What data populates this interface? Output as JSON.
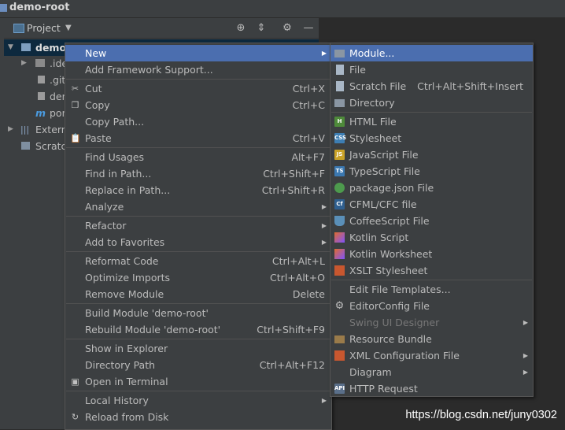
{
  "window": {
    "title": "demo-root"
  },
  "panel": {
    "title": "Project",
    "tree": [
      {
        "label": "demo-",
        "bold": true
      },
      {
        "label": ".ide"
      },
      {
        "label": ".giti"
      },
      {
        "label": "dem"
      },
      {
        "label": "pon"
      },
      {
        "label": "Externa"
      },
      {
        "label": "Scratch"
      }
    ]
  },
  "context_menu": {
    "items": [
      {
        "label": "New",
        "shortcut": "",
        "submenu": true
      },
      {
        "label": "Add Framework Support...",
        "shortcut": ""
      },
      {
        "label": "Cut",
        "shortcut": "Ctrl+X",
        "icon": "cut-icon"
      },
      {
        "label": "Copy",
        "shortcut": "Ctrl+C",
        "icon": "copy-icon"
      },
      {
        "label": "Copy Path...",
        "shortcut": ""
      },
      {
        "label": "Paste",
        "shortcut": "Ctrl+V",
        "icon": "paste-icon"
      },
      {
        "label": "Find Usages",
        "shortcut": "Alt+F7"
      },
      {
        "label": "Find in Path...",
        "shortcut": "Ctrl+Shift+F"
      },
      {
        "label": "Replace in Path...",
        "shortcut": "Ctrl+Shift+R"
      },
      {
        "label": "Analyze",
        "shortcut": "",
        "submenu": true
      },
      {
        "label": "Refactor",
        "shortcut": "",
        "submenu": true
      },
      {
        "label": "Add to Favorites",
        "shortcut": "",
        "submenu": true
      },
      {
        "label": "Reformat Code",
        "shortcut": "Ctrl+Alt+L"
      },
      {
        "label": "Optimize Imports",
        "shortcut": "Ctrl+Alt+O"
      },
      {
        "label": "Remove Module",
        "shortcut": "Delete"
      },
      {
        "label": "Build Module 'demo-root'",
        "shortcut": ""
      },
      {
        "label": "Rebuild Module 'demo-root'",
        "shortcut": "Ctrl+Shift+F9"
      },
      {
        "label": "Show in Explorer",
        "shortcut": ""
      },
      {
        "label": "Directory Path",
        "shortcut": "Ctrl+Alt+F12"
      },
      {
        "label": "Open in Terminal",
        "shortcut": "",
        "icon": "terminal-icon"
      },
      {
        "label": "Local History",
        "shortcut": "",
        "submenu": true
      },
      {
        "label": "Reload from Disk",
        "shortcut": "",
        "icon": "reload-icon"
      }
    ]
  },
  "new_submenu": {
    "items": [
      {
        "label": "Module...",
        "shortcut": "",
        "icon": "module-icon"
      },
      {
        "label": "File",
        "shortcut": "",
        "icon": "file-icon"
      },
      {
        "label": "Scratch File",
        "shortcut": "Ctrl+Alt+Shift+Insert",
        "icon": "scratch-file-icon"
      },
      {
        "label": "Directory",
        "shortcut": "",
        "icon": "folder-icon"
      },
      {
        "label": "HTML File",
        "shortcut": "",
        "icon": "html-icon",
        "badge": "H"
      },
      {
        "label": "Stylesheet",
        "shortcut": "",
        "icon": "css-icon",
        "badge": "CSS"
      },
      {
        "label": "JavaScript File",
        "shortcut": "",
        "icon": "javascript-icon",
        "badge": "JS"
      },
      {
        "label": "TypeScript File",
        "shortcut": "",
        "icon": "typescript-icon",
        "badge": "TS"
      },
      {
        "label": "package.json File",
        "shortcut": "",
        "icon": "npm-icon"
      },
      {
        "label": "CFML/CFC file",
        "shortcut": "",
        "icon": "cfml-icon",
        "badge": "Cf"
      },
      {
        "label": "CoffeeScript File",
        "shortcut": "",
        "icon": "coffeescript-icon"
      },
      {
        "label": "Kotlin Script",
        "shortcut": "",
        "icon": "kotlin-icon"
      },
      {
        "label": "Kotlin Worksheet",
        "shortcut": "",
        "icon": "kotlin-icon"
      },
      {
        "label": "XSLT Stylesheet",
        "shortcut": "",
        "icon": "xslt-icon"
      },
      {
        "label": "Edit File Templates...",
        "shortcut": ""
      },
      {
        "label": "EditorConfig File",
        "shortcut": "",
        "icon": "gear-icon"
      },
      {
        "label": "Swing UI Designer",
        "shortcut": "",
        "submenu": true,
        "disabled": true
      },
      {
        "label": "Resource Bundle",
        "shortcut": "",
        "icon": "resource-bundle-icon"
      },
      {
        "label": "XML Configuration File",
        "shortcut": "",
        "submenu": true,
        "icon": "xml-icon"
      },
      {
        "label": "Diagram",
        "shortcut": "",
        "submenu": true
      },
      {
        "label": "HTTP Request",
        "shortcut": "",
        "icon": "api-icon",
        "badge": "API"
      }
    ]
  },
  "watermark": "https://blog.csdn.net/juny0302",
  "colors": {
    "highlight": "#4b6eaf",
    "menu_bg": "#3c3f41",
    "separator": "#515151",
    "selection": "#0d293e"
  }
}
